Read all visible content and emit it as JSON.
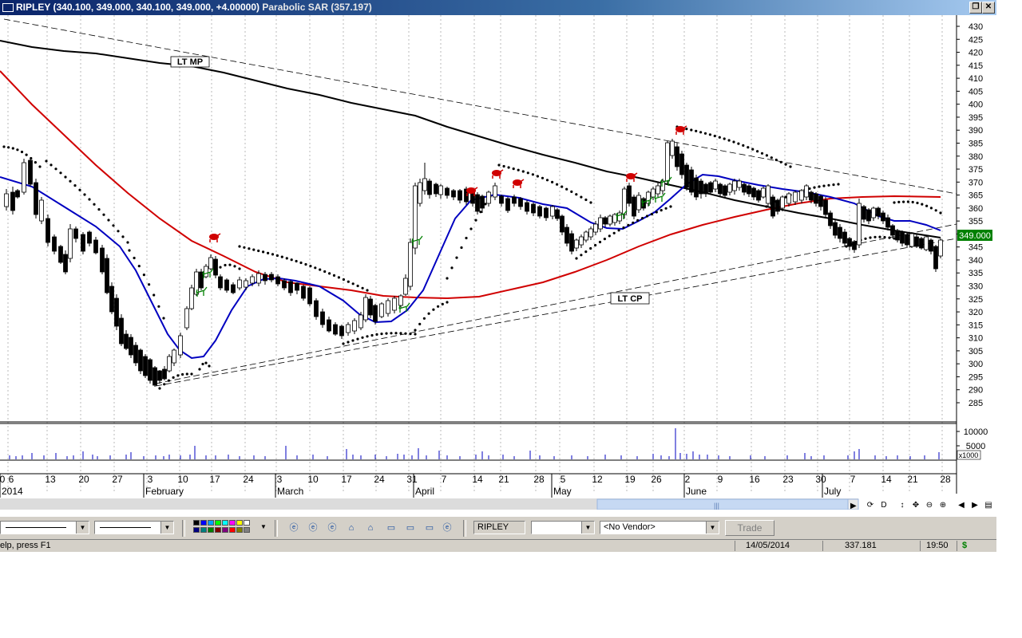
{
  "window": {
    "symbol": "RIPLEY",
    "ohlc": "(340.100, 349.000, 340.100, 349.000, +4.00000)",
    "indicator": "Parabolic SAR (357.197)"
  },
  "price_axis": {
    "labels": [
      "430",
      "425",
      "420",
      "415",
      "410",
      "405",
      "400",
      "395",
      "390",
      "385",
      "380",
      "375",
      "370",
      "365",
      "360",
      "355",
      "350",
      "345",
      "340",
      "335",
      "330",
      "325",
      "320",
      "315",
      "310",
      "305",
      "300",
      "295",
      "290",
      "285"
    ],
    "current_price": "349.000"
  },
  "volume_axis": {
    "labels": [
      "10000",
      "5000"
    ],
    "multiplier": "x1000"
  },
  "date_axis": {
    "days": [
      "0",
      "6",
      "13",
      "20",
      "27",
      "3",
      "10",
      "17",
      "24",
      "3",
      "10",
      "17",
      "24",
      "31",
      "7",
      "14",
      "21",
      "28",
      "5",
      "12",
      "19",
      "26",
      "2",
      "9",
      "16",
      "23",
      "30",
      "7",
      "14",
      "21",
      "28"
    ],
    "months": [
      "2014",
      "February",
      "March",
      "April",
      "May",
      "June",
      "July"
    ]
  },
  "annotations": {
    "lt_mp": "LT MP",
    "lt_cp": "LT CP"
  },
  "colors": {
    "ma_short": "#0000c0",
    "ma_medium": "#d00000",
    "ma_long": "#000000",
    "bear_icon": "#d00000",
    "bull_icon": "#008000",
    "price_badge_bg": "#008000"
  },
  "toolbar": {
    "symbol_field": "RIPLEY",
    "vendor_select": "<No Vendor>",
    "trade_button": "Trade",
    "nav_labels": [
      "D"
    ]
  },
  "statusbar": {
    "help_text": "elp, press F1",
    "date": "14/05/2014",
    "value": "337.181",
    "time": "19:50",
    "currency": "$"
  }
}
